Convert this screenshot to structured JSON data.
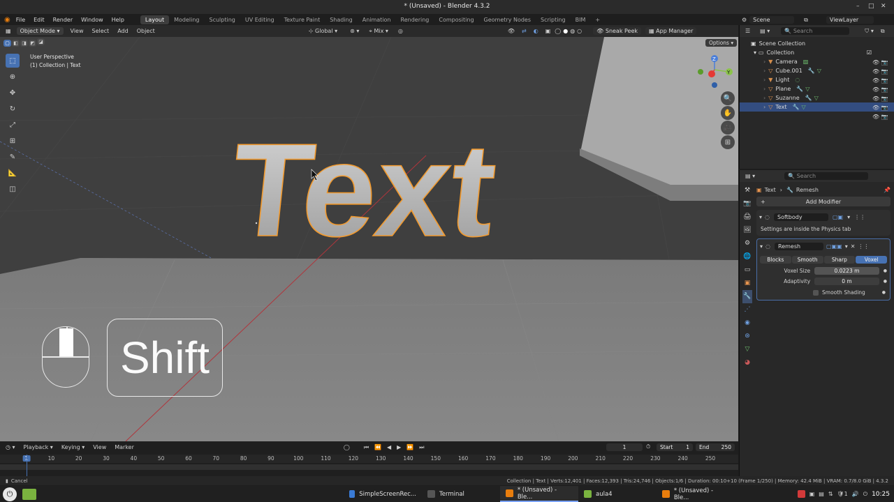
{
  "window": {
    "title": "* (Unsaved) - Blender 4.3.2",
    "minimize": "–",
    "maximize": "□",
    "close": "✕"
  },
  "menu": [
    "File",
    "Edit",
    "Render",
    "Window",
    "Help"
  ],
  "workspaces": [
    {
      "label": "Layout",
      "active": true
    },
    {
      "label": "Modeling"
    },
    {
      "label": "Sculpting"
    },
    {
      "label": "UV Editing"
    },
    {
      "label": "Texture Paint"
    },
    {
      "label": "Shading"
    },
    {
      "label": "Animation"
    },
    {
      "label": "Rendering"
    },
    {
      "label": "Compositing"
    },
    {
      "label": "Geometry Nodes"
    },
    {
      "label": "Scripting"
    },
    {
      "label": "BIM"
    },
    {
      "label": "+"
    }
  ],
  "scene": {
    "name": "Scene",
    "view_layer": "ViewLayer"
  },
  "viewport_header": {
    "mode": "Object Mode",
    "menus": [
      "View",
      "Select",
      "Add",
      "Object"
    ],
    "orientation": "Global",
    "snap_mode": "Mix",
    "sneak_peek": "Sneak Peek",
    "app_manager": "App Manager",
    "options": "Options"
  },
  "viewport": {
    "perspective": "User Perspective",
    "collection_info": "(1) Collection | Text",
    "text_object": "Text",
    "key_overlay": "Shift",
    "gizmo": {
      "z": "Z",
      "y": "Y"
    }
  },
  "outliner": {
    "search_placeholder": "Search",
    "scene_collection": "Scene Collection",
    "collection": "Collection",
    "items": [
      {
        "name": "Camera",
        "color": "#d58e4c"
      },
      {
        "name": "Cube.001",
        "color": "#e8954f"
      },
      {
        "name": "Light",
        "color": "#d58e4c"
      },
      {
        "name": "Plane",
        "color": "#e8954f"
      },
      {
        "name": "Suzanne",
        "color": "#e8954f"
      },
      {
        "name": "Text",
        "color": "#e8954f",
        "selected": true
      }
    ]
  },
  "properties": {
    "search_placeholder": "Search",
    "breadcrumb_object": "Text",
    "breadcrumb_modifier": "Remesh",
    "add_modifier": "Add Modifier",
    "softbody": {
      "name": "Softbody",
      "note": "Settings are inside the Physics tab"
    },
    "remesh": {
      "name": "Remesh",
      "modes": [
        "Blocks",
        "Smooth",
        "Sharp",
        "Voxel"
      ],
      "active_mode": "Voxel",
      "voxel_size_label": "Voxel Size",
      "voxel_size": "0.0223 m",
      "adaptivity_label": "Adaptivity",
      "adaptivity": "0 m",
      "smooth_shading": "Smooth Shading"
    }
  },
  "timeline": {
    "menus": [
      "Playback",
      "Keying",
      "View",
      "Marker"
    ],
    "current_frame": "1",
    "start_label": "Start",
    "start": "1",
    "end_label": "End",
    "end": "250",
    "ticks": [
      "1",
      "10",
      "20",
      "30",
      "40",
      "50",
      "60",
      "70",
      "80",
      "90",
      "100",
      "110",
      "120",
      "130",
      "140",
      "150",
      "160",
      "170",
      "180",
      "190",
      "200",
      "210",
      "220",
      "230",
      "240",
      "250"
    ]
  },
  "status": {
    "left": "Cancel",
    "right": "Collection | Text | Verts:12,401 | Faces:12,393 | Tris:24,746 | Objects:1/6 | Duration: 00:10+10 (Frame 1/250) | Memory: 42.4 MiB | VRAM: 0.7/8.0 GiB | 4.3.2"
  },
  "taskbar": {
    "tasks": [
      {
        "label": "SimpleScreenRec...",
        "color": "#3a7bd5"
      },
      {
        "label": "Terminal",
        "color": "#555555"
      },
      {
        "label": "* (Unsaved) - Ble...",
        "color": "#e87d0d",
        "active": true
      },
      {
        "label": "aula4",
        "color": "#7ab33f"
      },
      {
        "label": "* (Unsaved) - Ble...",
        "color": "#e87d0d"
      }
    ],
    "tray_1": "1",
    "clock": "10:25"
  }
}
